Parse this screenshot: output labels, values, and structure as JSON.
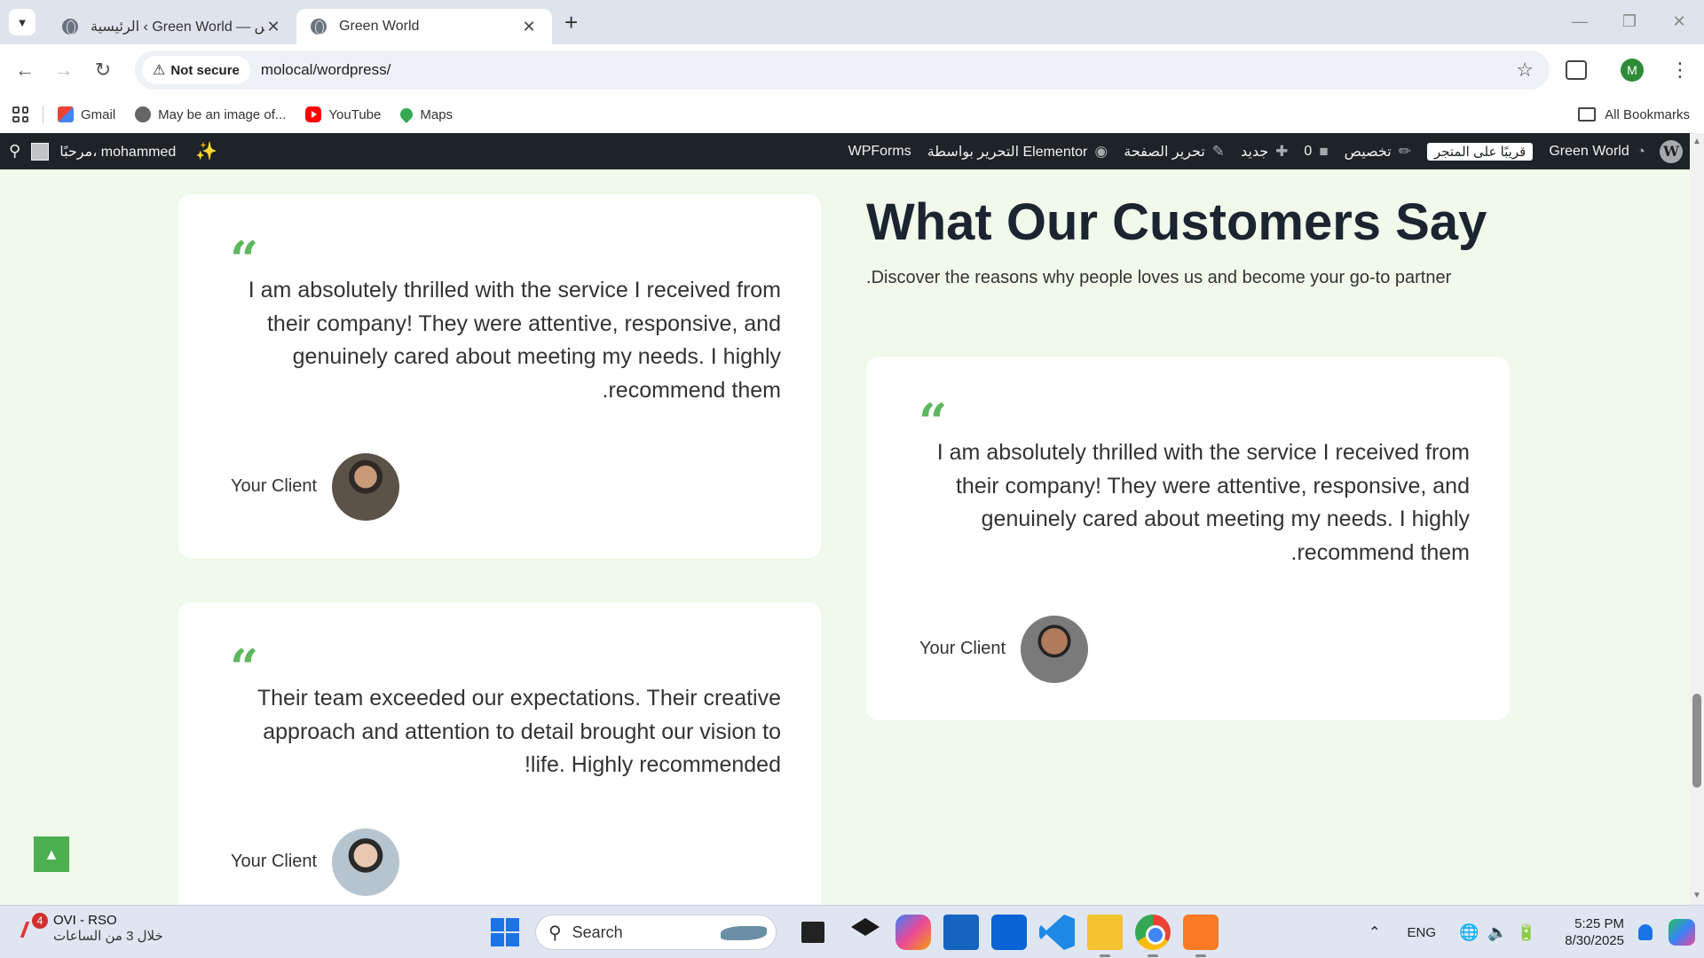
{
  "browser": {
    "tabs": [
      {
        "title": "الرئيسية ‹ Green World — ووردبريس",
        "active": false
      },
      {
        "title": "Green World",
        "active": true
      }
    ],
    "address": {
      "security_label": "Not secure",
      "url": "molocal/wordpress/"
    },
    "profile_initial": "M",
    "bookmarks": [
      {
        "label": "Gmail",
        "icon": "gmail-icon"
      },
      {
        "label": "May be an image of...",
        "icon": "facebook-icon"
      },
      {
        "label": "YouTube",
        "icon": "youtube-icon"
      },
      {
        "label": "Maps",
        "icon": "maps-icon"
      }
    ],
    "all_bookmarks_label": "All Bookmarks"
  },
  "wp_admin_bar": {
    "greeting": "مرحبًا، mohammed",
    "items": [
      {
        "label": "WPForms"
      },
      {
        "label": "التحرير بواسطة Elementor"
      },
      {
        "label": "تحرير الصفحة"
      },
      {
        "label": "جديد"
      },
      {
        "label": "0"
      },
      {
        "label": "تخصيص"
      }
    ],
    "coming_soon_label": "قريبًا على المتجر",
    "site_name": "Green World"
  },
  "section": {
    "title": "What Our Customers Say",
    "subtitle": "Discover the reasons why people loves us and become your go-to partner."
  },
  "testimonials": [
    {
      "text": "I am absolutely thrilled with the service I received from their company! They were attentive, responsive, and genuinely cared about meeting my needs. I highly recommend them.",
      "client": "Your Client"
    },
    {
      "text": "I am absolutely thrilled with the service I received from their company! They were attentive, responsive, and genuinely cared about meeting my needs. I highly recommend them.",
      "client": "Your Client"
    },
    {
      "text": "Their team exceeded our expectations. Their creative approach and attention to detail brought our vision to life. Highly recommended!",
      "client": "Your Client"
    }
  ],
  "colors": {
    "accent_green": "#5cb85c",
    "page_background": "#f0f9ea",
    "wp_bar": "#1d2327"
  },
  "taskbar": {
    "widget_title": "OVI - RSO",
    "widget_subtitle": "خلال 3 من الساعات",
    "widget_badge": "4",
    "search_placeholder": "Search",
    "language": "ENG",
    "time": "5:25 PM",
    "date": "8/30/2025"
  }
}
